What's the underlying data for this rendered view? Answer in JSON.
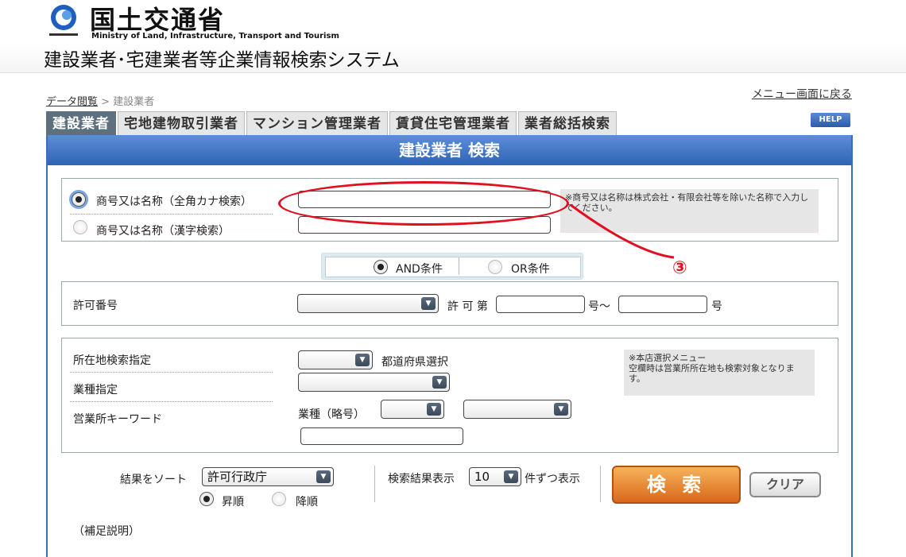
{
  "header": {
    "ministry": "国土交通省",
    "ministry_en": "Ministry of Land, Infrastructure, Transport and Tourism",
    "system_title": "建設業者･宅建業者等企業情報検索システム"
  },
  "breadcrumb": {
    "link": "データ閲覧",
    "sep": ">",
    "current": "建設業者"
  },
  "back_link": "メニュー画面に戻る",
  "tabs": [
    {
      "label": "建設業者"
    },
    {
      "label": "宅地建物取引業者"
    },
    {
      "label": "マンション管理業者"
    },
    {
      "label": "賃貸住宅管理業者"
    },
    {
      "label": "業者総括検索"
    }
  ],
  "help": "HELP",
  "panel": {
    "title": "建設業者 検索"
  },
  "name_search": {
    "opt_kana": "商号又は名称（全角カナ検索）",
    "opt_kanji": "商号又は名称（漢字検索）",
    "note": "※商号又は名称は株式会社・有限会社等を除いた名称で入力してください。"
  },
  "condition": {
    "and": "AND条件",
    "or": "OR条件"
  },
  "permit": {
    "label": "許可番号",
    "dai": "許 可 第",
    "go_range": "号～",
    "go": "号"
  },
  "location": {
    "label_loc": "所在地検索指定",
    "pref": "都道府県選択",
    "label_industry": "業種指定",
    "label_keyword": "営業所キーワード",
    "industry_abbr": "業種（略号）",
    "note": "※本店選択メニュー\n空欄時は営業所所在地も検索対象となります。"
  },
  "sort": {
    "label": "結果をソート",
    "value": "許可行政庁",
    "asc": "昇順",
    "desc": "降順"
  },
  "display": {
    "label": "検索結果表示",
    "value": "10",
    "suffix": "件ずつ表示"
  },
  "buttons": {
    "search": "検 索",
    "clear": "クリア"
  },
  "supplement": {
    "title": "（補足説明）"
  },
  "annotation": {
    "marker": "③"
  },
  "colors": {
    "tab_active": "#5e6f7d",
    "panel_blue": "#3d6db5",
    "search_orange": "#e07a24",
    "annotation_red": "#e01020"
  }
}
